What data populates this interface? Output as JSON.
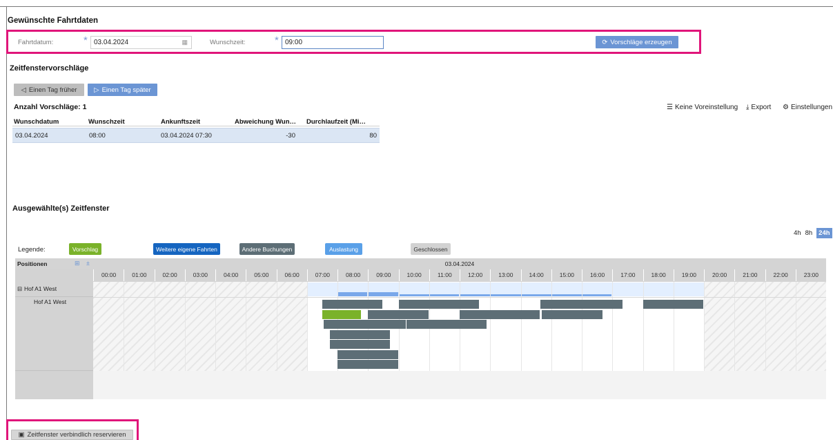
{
  "header": {
    "title": "Gewünschte Fahrtdaten"
  },
  "form": {
    "date_label": "Fahrtdatum:",
    "date_value": "03.04.2024",
    "time_label": "Wunschzeit:",
    "time_value": "09:00",
    "generate_label": "Vorschläge erzeugen",
    "required_marker": "*"
  },
  "proposals": {
    "title": "Zeitfenstervorschläge",
    "prev_day_label": "Einen Tag früher",
    "next_day_label": "Einen Tag später",
    "count_label": "Anzahl Vorschläge: 1",
    "toolbar": {
      "preset_label": "Keine Voreinstellung",
      "export_label": "Export",
      "settings_label": "Einstellungen"
    },
    "columns": [
      "Wunschdatum",
      "Wunschzeit",
      "Ankunftszeit",
      "Abweichung Wun…",
      "Durchlaufzeit (Mi…"
    ],
    "rows": [
      [
        "03.04.2024",
        "08:00",
        "03.04.2024 07:30",
        "-30",
        "80"
      ]
    ]
  },
  "selected": {
    "title": "Ausgewählte(s) Zeitfenster",
    "zoom": {
      "options": [
        "4h",
        "8h",
        "24h"
      ],
      "active": "24h"
    },
    "legend": {
      "label": "Legende:",
      "items": [
        {
          "label": "Vorschlag",
          "color": "#7ab22a",
          "text_color": "#ffffff"
        },
        {
          "label": "Weitere eigene Fahrten",
          "color": "#1565c0",
          "text_color": "#ffffff"
        },
        {
          "label": "Andere Buchungen",
          "color": "#5d6e76",
          "text_color": "#ffffff"
        },
        {
          "label": "Auslastung",
          "color": "#5aa0e8",
          "text_color": "#ffffff"
        },
        {
          "label": "Geschlossen",
          "color": "#d2d2d2",
          "text_color": "#333333"
        }
      ]
    },
    "gantt": {
      "positions_label": "Positionen",
      "date_label": "03.04.2024",
      "hours": [
        "00:00",
        "01:00",
        "02:00",
        "03:00",
        "04:00",
        "05:00",
        "06:00",
        "07:00",
        "08:00",
        "09:00",
        "10:00",
        "11:00",
        "12:00",
        "13:00",
        "14:00",
        "15:00",
        "16:00",
        "17:00",
        "18:00",
        "19:00",
        "20:00",
        "21:00",
        "22:00",
        "23:00"
      ],
      "group_label": "Hof A1 West",
      "resource_label": "Hof A1 West",
      "open_from_hour": 7,
      "open_to_hour": 20,
      "bookings": [
        {
          "lane": 0,
          "start": 7.5,
          "end": 9.5,
          "type": "other"
        },
        {
          "lane": 0,
          "start": 10.0,
          "end": 12.65,
          "type": "other"
        },
        {
          "lane": 0,
          "start": 14.65,
          "end": 17.35,
          "type": "other"
        },
        {
          "lane": 0,
          "start": 18.0,
          "end": 20.0,
          "type": "other"
        },
        {
          "lane": 1,
          "start": 7.5,
          "end": 8.8,
          "type": "proposal"
        },
        {
          "lane": 1,
          "start": 9.0,
          "end": 11.0,
          "type": "other"
        },
        {
          "lane": 1,
          "start": 12.0,
          "end": 14.65,
          "type": "other"
        },
        {
          "lane": 1,
          "start": 14.7,
          "end": 16.7,
          "type": "other"
        },
        {
          "lane": 2,
          "start": 7.55,
          "end": 10.25,
          "type": "other"
        },
        {
          "lane": 2,
          "start": 10.25,
          "end": 12.9,
          "type": "other"
        },
        {
          "lane": 3,
          "start": 7.75,
          "end": 9.75,
          "type": "other"
        },
        {
          "lane": 4,
          "start": 7.75,
          "end": 9.75,
          "type": "other"
        },
        {
          "lane": 5,
          "start": 8.0,
          "end": 10.0,
          "type": "other"
        },
        {
          "lane": 6,
          "start": 8.0,
          "end": 10.0,
          "type": "other"
        }
      ],
      "utilization": [
        {
          "start": 8.0,
          "end": 9.0,
          "level": 0.3
        },
        {
          "start": 9.0,
          "end": 10.0,
          "level": 0.3
        },
        {
          "start": 10.0,
          "end": 12.0,
          "level": 0.15
        },
        {
          "start": 12.0,
          "end": 17.0,
          "level": 0.15
        }
      ]
    }
  },
  "footer": {
    "reserve_label": "Zeitfenster verbindlich reservieren"
  }
}
